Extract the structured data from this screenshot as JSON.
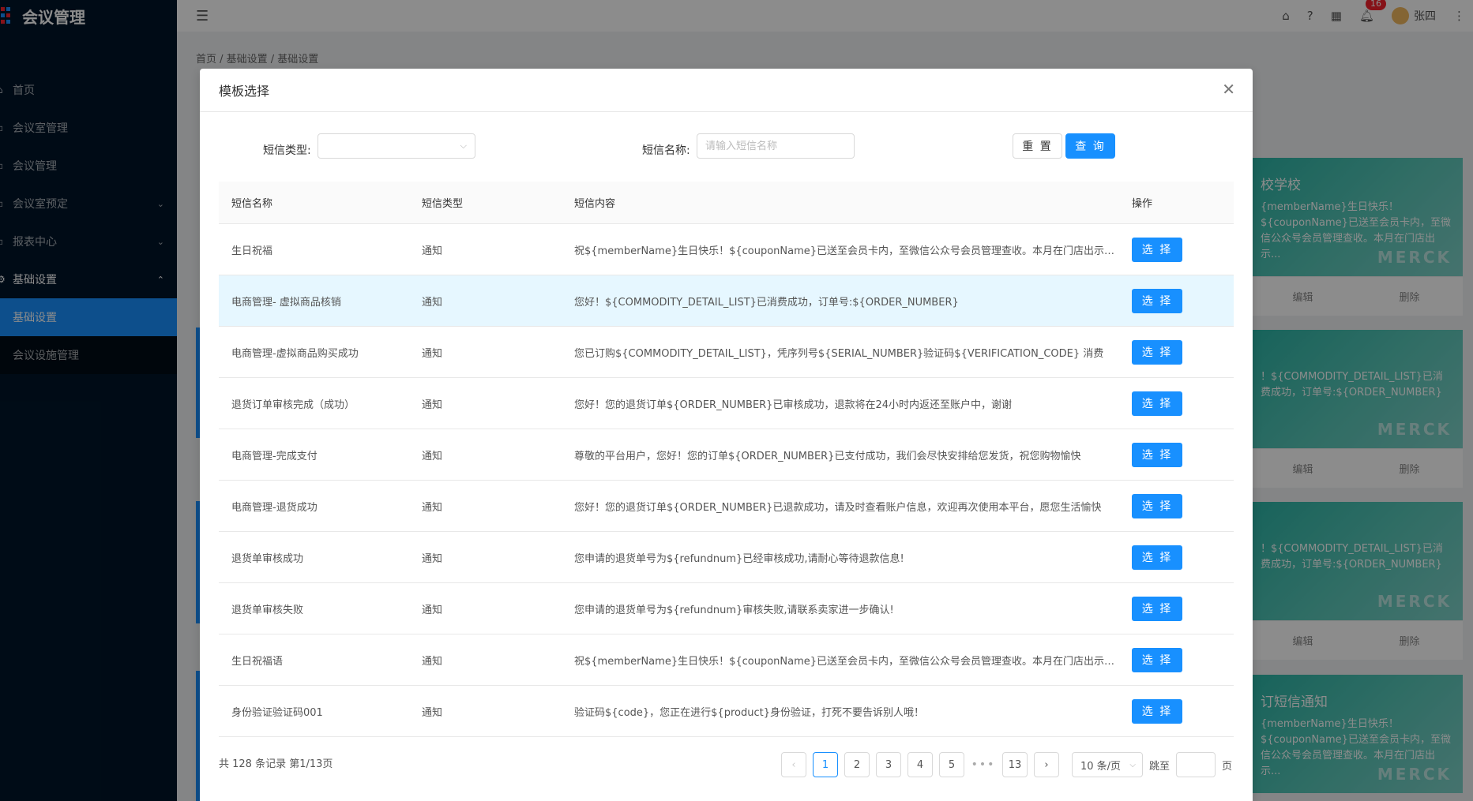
{
  "app": {
    "title": "会议管理"
  },
  "sidebar": {
    "items": [
      {
        "label": "首页",
        "icon": "home-icon"
      },
      {
        "label": "会议室管理",
        "icon": "room-icon"
      },
      {
        "label": "会议管理",
        "icon": "meeting-icon"
      },
      {
        "label": "会议室预定",
        "icon": "calendar-icon",
        "arrow": "⌄"
      },
      {
        "label": "报表中心",
        "icon": "report-icon",
        "arrow": "⌄"
      },
      {
        "label": "基础设置",
        "icon": "settings-icon",
        "arrow": "⌃"
      }
    ],
    "subitems": [
      {
        "label": "基础设置",
        "active": true
      },
      {
        "label": "会议设施管理",
        "active": false
      }
    ]
  },
  "header": {
    "notification_count": "16",
    "user_name": "张四"
  },
  "breadcrumb": "首页 / 基础设置 / 基础设置",
  "bg_cards": [
    {
      "title": "校学校",
      "body": "{memberName}生日快乐！${couponName}已送至会员卡内，至微信公众号会员管理查收。本月在门店出示...",
      "watermark": "MERCK",
      "edit": "编辑",
      "delete": "删除"
    },
    {
      "title": "",
      "body": "！${COMMODITY_DETAIL_LIST}已消费成功，订单号:${ORDER_NUMBER}",
      "watermark": "MERCK",
      "edit": "编辑",
      "delete": "删除"
    },
    {
      "title": "",
      "body": "！${COMMODITY_DETAIL_LIST}已消费成功，订单号:${ORDER_NUMBER}",
      "watermark": "MERCK",
      "edit": "编辑",
      "delete": "删除"
    },
    {
      "title": "订短信通知",
      "body": "{memberName}生日快乐！${couponName}已送至会员卡内，至微信公众号会员管理查收。本月在门店出示...",
      "watermark": "MERCK"
    }
  ],
  "modal": {
    "title": "模板选择",
    "filter": {
      "type_label": "短信类型:",
      "name_label": "短信名称:",
      "name_placeholder": "请输入短信名称",
      "reset": "重 置",
      "query": "查 询"
    },
    "table": {
      "headers": [
        "短信名称",
        "短信类型",
        "短信内容",
        "操作"
      ],
      "select_label": "选 择",
      "rows": [
        {
          "name": "生日祝福",
          "type": "通知",
          "content": "祝${memberName}生日快乐！${couponName}已送至会员卡内，至微信公众号会员管理查收。本月在门店出示会员卡可享受生日特惠"
        },
        {
          "name": "电商管理- 虚拟商品核销",
          "type": "通知",
          "content": "您好！${COMMODITY_DETAIL_LIST}已消费成功，订单号:${ORDER_NUMBER}"
        },
        {
          "name": "电商管理-虚拟商品购买成功",
          "type": "通知",
          "content": "您已订购${COMMODITY_DETAIL_LIST}，凭序列号${SERIAL_NUMBER}验证码${VERIFICATION_CODE} 消费"
        },
        {
          "name": "退货订单审核完成（成功）",
          "type": "通知",
          "content": "您好！您的退货订单${ORDER_NUMBER}已审核成功，退款将在24小时内返还至账户中，谢谢"
        },
        {
          "name": "电商管理-完成支付",
          "type": "通知",
          "content": "尊敬的平台用户，您好！您的订单${ORDER_NUMBER}已支付成功，我们会尽快安排给您发货，祝您购物愉快"
        },
        {
          "name": "电商管理-退货成功",
          "type": "通知",
          "content": "您好！您的退货订单${ORDER_NUMBER}已退款成功，请及时查看账户信息，欢迎再次使用本平台，愿您生活愉快"
        },
        {
          "name": "退货单审核成功",
          "type": "通知",
          "content": "您申请的退货单号为${refundnum}已经审核成功,请耐心等待退款信息!"
        },
        {
          "name": "退货单审核失败",
          "type": "通知",
          "content": "您申请的退货单号为${refundnum}审核失败,请联系卖家进一步确认!"
        },
        {
          "name": "生日祝福语",
          "type": "通知",
          "content": "祝${memberName}生日快乐！${couponName}已送至会员卡内，至微信公众号会员管理查收。本月在门店出示会员卡可享受生日特惠"
        },
        {
          "name": "身份验证验证码001",
          "type": "通知",
          "content": "验证码${code}，您正在进行${product}身份验证，打死不要告诉别人哦！"
        }
      ]
    },
    "pagination": {
      "total_text": "共 128 条记录 第1/13页",
      "prev": "‹",
      "pages": [
        "1",
        "2",
        "3",
        "4",
        "5"
      ],
      "ellipsis": "•••",
      "last": "13",
      "next": "›",
      "page_size": "10 条/页",
      "jump_label": "跳至",
      "page_label": "页",
      "current": 1
    }
  },
  "colors": {
    "primary": "#1890ff",
    "sidebar": "#001529",
    "highlight_row": "#e6f7ff"
  }
}
